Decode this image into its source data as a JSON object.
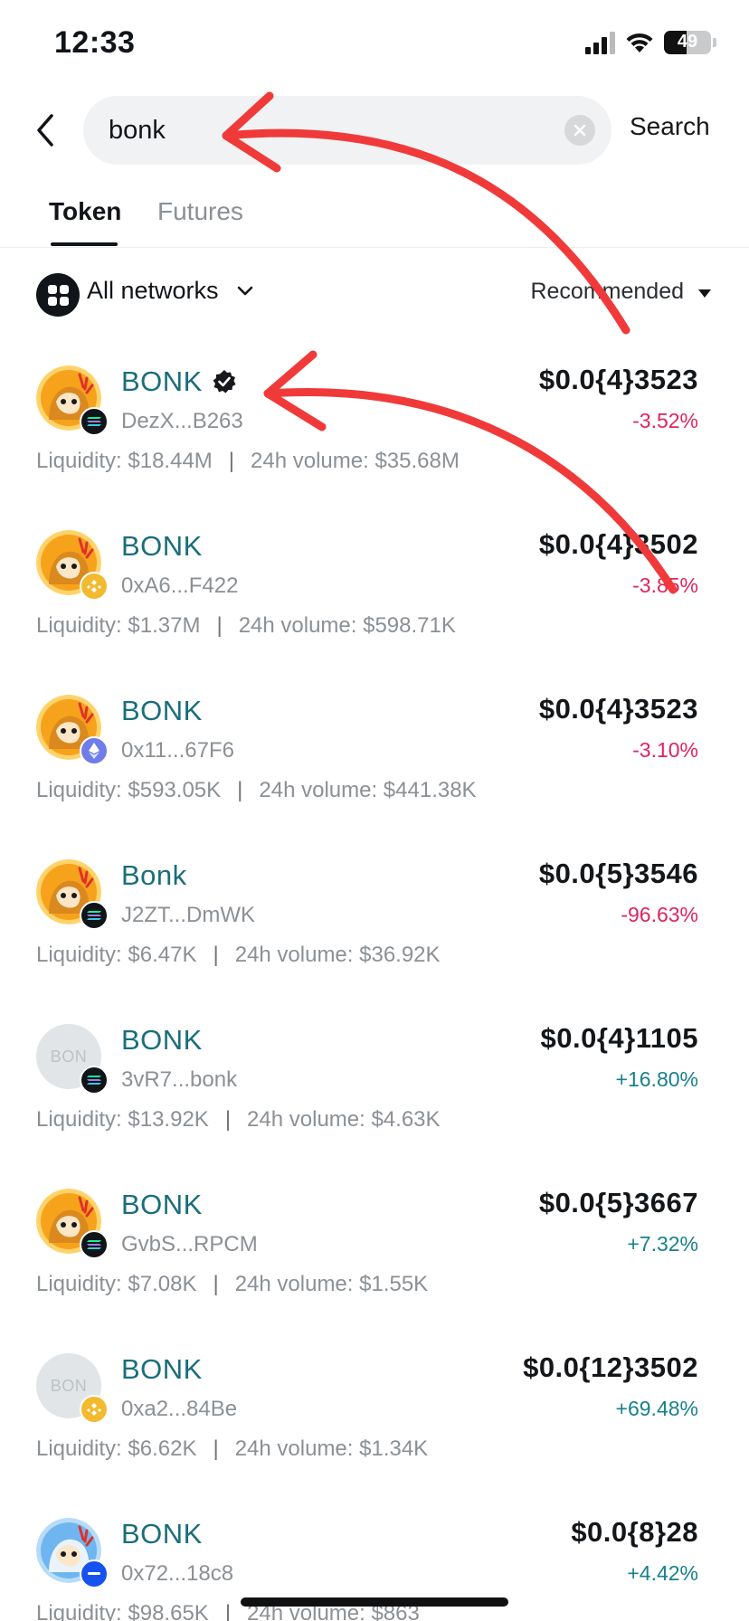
{
  "status_bar": {
    "time": "12:33",
    "battery": "49",
    "battery_level": 0.49
  },
  "search": {
    "value": "bonk",
    "placeholder": "Search",
    "button_label": "Search"
  },
  "tabs": [
    {
      "label": "Token",
      "active": true
    },
    {
      "label": "Futures",
      "active": false
    }
  ],
  "filter": {
    "network_label": "All networks",
    "sort_label": "Recommended"
  },
  "colors": {
    "accent": "#1a6e7a",
    "negative": "#e0245e",
    "positive": "#17818b",
    "arrow": "#f03a3a"
  },
  "tokens": [
    {
      "name": "BONK",
      "verified": true,
      "address": "DezX...B263",
      "price": "$0.0{4}3523",
      "change": "-3.52%",
      "liquidity_text": "Liquidity: $18.44M",
      "volume_text": "24h volume: $35.68M",
      "chain": "solana",
      "logo": "bonk-dog"
    },
    {
      "name": "BONK",
      "verified": false,
      "address": "0xA6...F422",
      "price": "$0.0{4}3502",
      "change": "-3.85%",
      "liquidity_text": "Liquidity: $1.37M",
      "volume_text": "24h volume: $598.71K",
      "chain": "bnb",
      "logo": "bonk-dog"
    },
    {
      "name": "BONK",
      "verified": false,
      "address": "0x11...67F6",
      "price": "$0.0{4}3523",
      "change": "-3.10%",
      "liquidity_text": "Liquidity: $593.05K",
      "volume_text": "24h volume: $441.38K",
      "chain": "ethereum",
      "logo": "bonk-dog"
    },
    {
      "name": "Bonk",
      "verified": false,
      "address": "J2ZT...DmWK",
      "price": "$0.0{5}3546",
      "change": "-96.63%",
      "liquidity_text": "Liquidity: $6.47K",
      "volume_text": "24h volume: $36.92K",
      "chain": "solana",
      "logo": "bonk-dog"
    },
    {
      "name": "BONK",
      "verified": false,
      "address": "3vR7...bonk",
      "price": "$0.0{4}1105",
      "change": "+16.80%",
      "liquidity_text": "Liquidity: $13.92K",
      "volume_text": "24h volume: $4.63K",
      "chain": "solana",
      "logo": "placeholder",
      "placeholder_text": "BON"
    },
    {
      "name": "BONK",
      "verified": false,
      "address": "GvbS...RPCM",
      "price": "$0.0{5}3667",
      "change": "+7.32%",
      "liquidity_text": "Liquidity: $7.08K",
      "volume_text": "24h volume: $1.55K",
      "chain": "solana",
      "logo": "bonk-dog"
    },
    {
      "name": "BONK",
      "verified": false,
      "address": "0xa2...84Be",
      "price": "$0.0{12}3502",
      "change": "+69.48%",
      "liquidity_text": "Liquidity: $6.62K",
      "volume_text": "24h volume: $1.34K",
      "chain": "bnb",
      "logo": "placeholder",
      "placeholder_text": "BON"
    },
    {
      "name": "BONK",
      "verified": false,
      "address": "0x72...18c8",
      "price": "$0.0{8}28",
      "change": "+4.42%",
      "liquidity_text": "Liquidity: $98.65K",
      "volume_text": "24h volume: $863",
      "chain": "base",
      "logo": "bonk-blue"
    }
  ]
}
